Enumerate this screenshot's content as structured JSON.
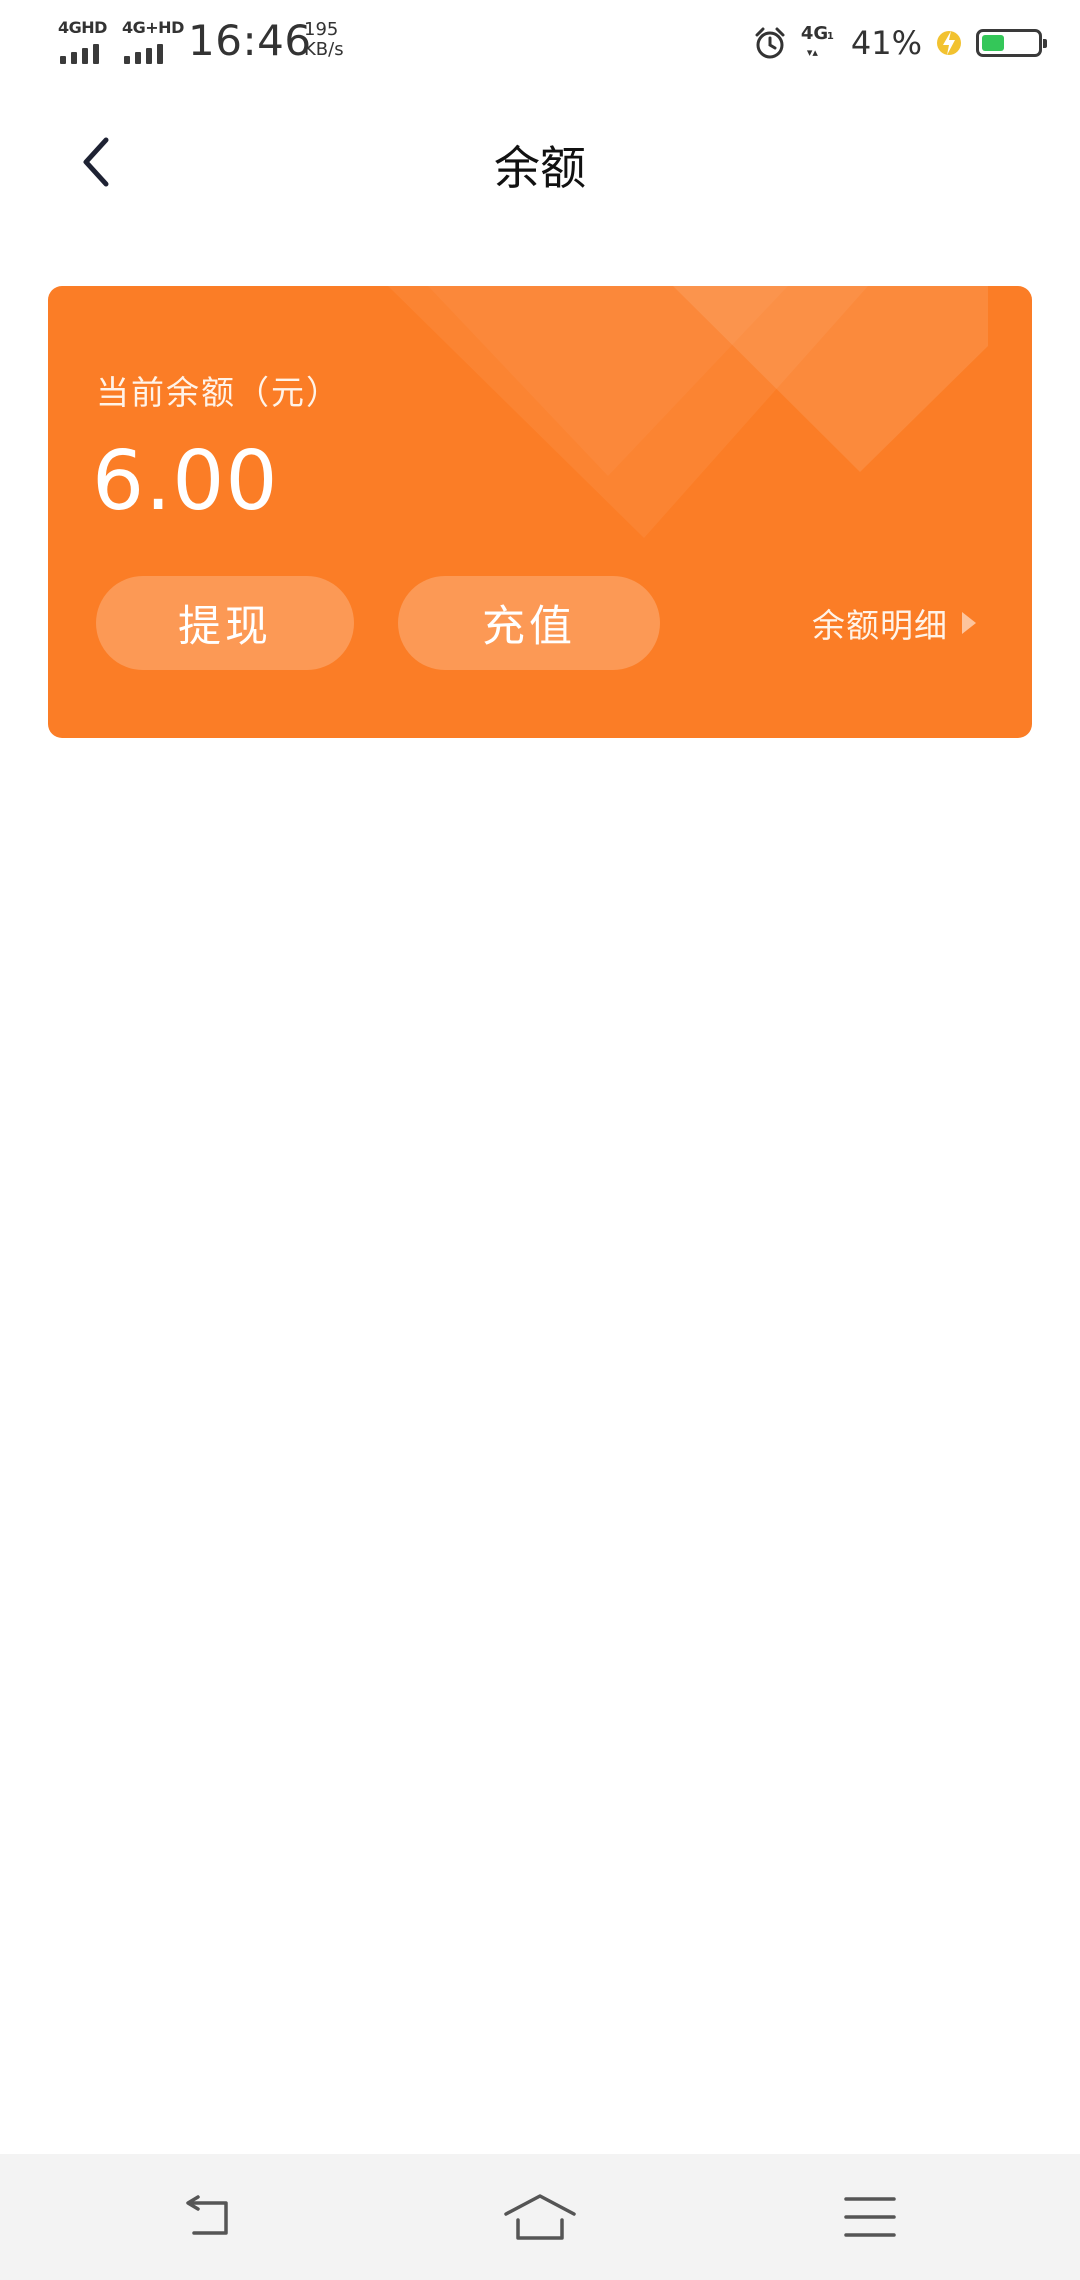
{
  "status_bar": {
    "sim1_label": "4GHD",
    "sim2_label": "4G+HD",
    "time": "16:46",
    "net_speed_value": "195",
    "net_speed_unit": "KB/s",
    "mobile_data_label": "4G",
    "mobile_data_sub": "1",
    "battery_percent_text": "41%",
    "battery_level": 0.41,
    "icons": [
      "signal-icon",
      "signal-icon",
      "alarm-icon",
      "mobile-data-icon",
      "charging-icon",
      "battery-icon"
    ]
  },
  "header": {
    "back_icon": "chevron-left-icon",
    "title": "余额"
  },
  "balance_card": {
    "label": "当前余额（元）",
    "amount": "6.00",
    "withdraw_label": "提现",
    "recharge_label": "充值",
    "detail_link_label": "余额明细",
    "detail_icon": "triangle-right-icon",
    "background_color": "#fb7d26"
  },
  "system_nav": {
    "icons": [
      "back-icon",
      "home-icon",
      "menu-icon"
    ]
  }
}
